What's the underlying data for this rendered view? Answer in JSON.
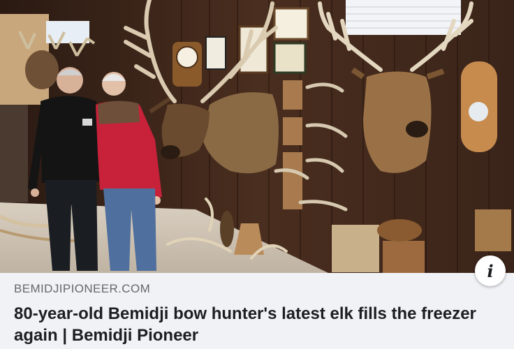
{
  "link_preview": {
    "image_alt": "Two people standing beside mounted elk heads and antlers on a wood-paneled wall",
    "domain": "BEMIDJIPIONEER.COM",
    "title": "80-year-old Bemidji bow hunter's latest elk fills the freezer again | Bemidji Pioneer",
    "info_label": "i",
    "info_icon": "info-icon"
  },
  "colors": {
    "background": "#f0f2f5",
    "title_text": "#1c1e21",
    "domain_text": "#65676b",
    "wall": "#3b2418"
  }
}
